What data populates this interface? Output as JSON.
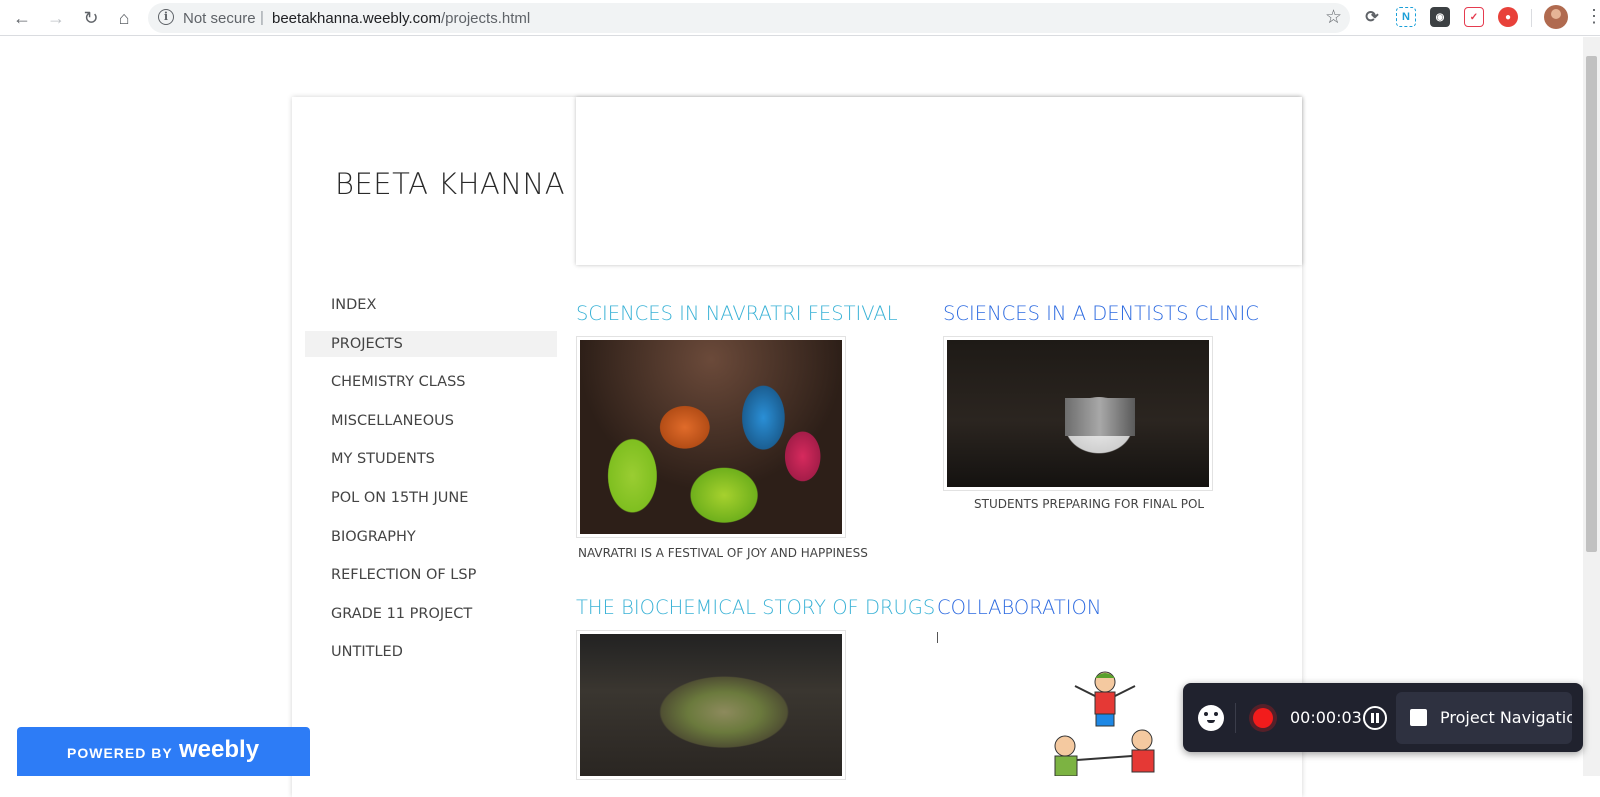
{
  "browser": {
    "security_label": "Not secure",
    "separator": "|",
    "url_host": "beetakhanna.weebly.com",
    "url_path": "/projects.html",
    "extensions": [
      "sync-icon",
      "n-extension-icon",
      "pocket-like-icon",
      "pocket-icon",
      "mask-icon"
    ]
  },
  "site": {
    "title": "BEETA KHANNA"
  },
  "nav": {
    "items": [
      {
        "label": "INDEX",
        "active": false
      },
      {
        "label": "PROJECTS",
        "active": true
      },
      {
        "label": "CHEMISTRY CLASS",
        "active": false
      },
      {
        "label": "MISCELLANEOUS",
        "active": false
      },
      {
        "label": "MY STUDENTS",
        "active": false
      },
      {
        "label": "POL ON 15TH JUNE",
        "active": false
      },
      {
        "label": "BIOGRAPHY",
        "active": false
      },
      {
        "label": "REFLECTION OF LSP",
        "active": false
      },
      {
        "label": "GRADE 11 PROJECT",
        "active": false
      },
      {
        "label": "UNTITLED",
        "active": false
      }
    ]
  },
  "projects": [
    {
      "title": "SCIENCES IN NAVRATRI FESTIVAL",
      "caption": "NAVRATRI IS A FESTIVAL OF JOY AND HAPPINESS"
    },
    {
      "title": "SCIENCES IN A DENTISTS CLINIC",
      "caption": "STUDENTS PREPARING FOR FINAL POL"
    },
    {
      "title": "THE BIOCHEMICAL STORY OF DRUGS",
      "caption": ""
    },
    {
      "title": "COLLABORATION",
      "caption": ""
    }
  ],
  "recorder": {
    "elapsed": "00:00:03",
    "tab_label": "Project Navigation"
  },
  "badge": {
    "prefix": "POWERED BY",
    "brand": "weebly"
  },
  "colors": {
    "title_cyan": "#3ab2d6",
    "title_blue": "#2c6ae0",
    "weebly_blue": "#2d7cf6",
    "recorder_bg": "#20222e",
    "record_red": "#f21c1c"
  }
}
